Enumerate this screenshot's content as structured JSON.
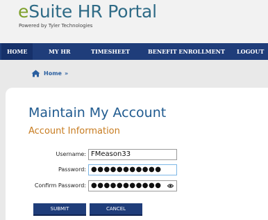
{
  "header": {
    "logo_e": "e",
    "logo_rest": "Suite HR Portal",
    "subtitle": "Powered by Tyler Technologies"
  },
  "nav": {
    "items": [
      {
        "label": "HOME"
      },
      {
        "label": "MY HR"
      },
      {
        "label": "TIMESHEET"
      },
      {
        "label": "BENEFIT ENROLLMENT"
      },
      {
        "label": "LOGOUT"
      }
    ],
    "active": "HOME"
  },
  "breadcrumb": {
    "icon": "home-icon",
    "label": "Home",
    "separator": "»"
  },
  "main": {
    "title": "Maintain My Account",
    "section_title": "Account Information",
    "form": {
      "username_label": "Username:",
      "username_value": "FMeason33",
      "password_label": "Password:",
      "password_value": "●●●●●●●●●●●",
      "confirm_label": "Confirm Password:",
      "confirm_value": "●●●●●●●●●●●",
      "reveal_icon": "eye-icon"
    },
    "buttons": {
      "submit": "SUBMIT",
      "cancel": "CANCEL"
    }
  },
  "colors": {
    "brand_green": "#7ea02b",
    "brand_blue": "#2f6b86",
    "nav_bg": "#1f3d7a",
    "title_blue": "#1f5a8f",
    "section_orange": "#c77b1f"
  }
}
